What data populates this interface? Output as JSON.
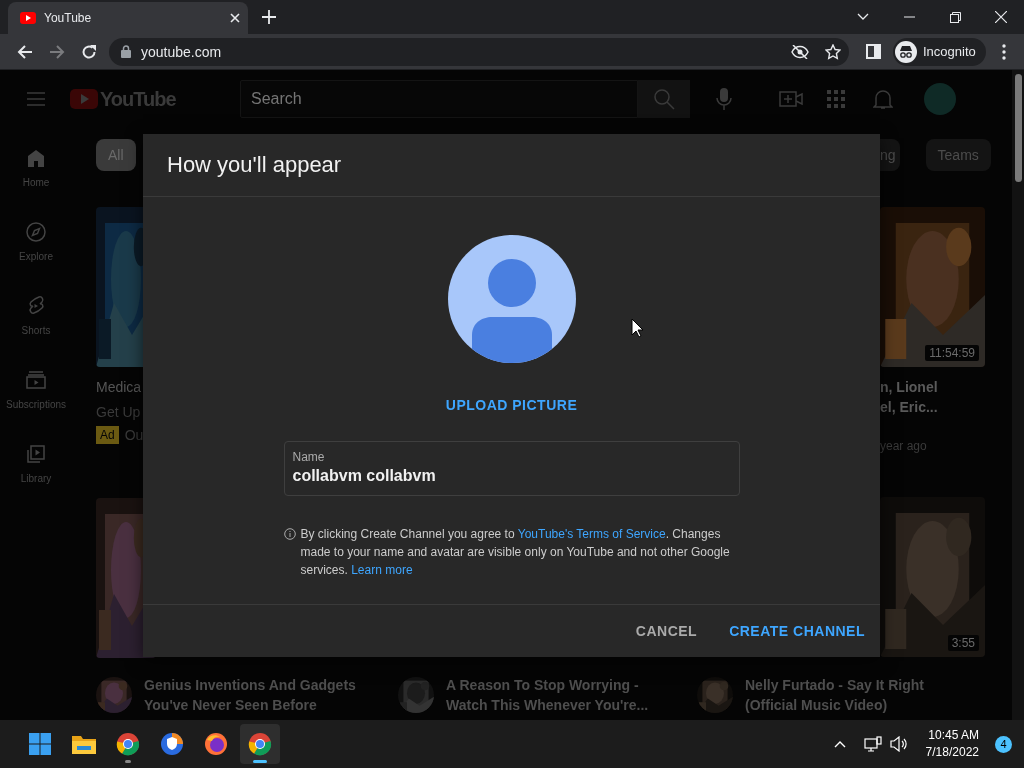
{
  "browser": {
    "tab": {
      "title": "YouTube"
    },
    "address": "youtube.com",
    "profile": "Incognito"
  },
  "masthead": {
    "logo": "YouTube",
    "search_placeholder": "Search"
  },
  "sidebar": {
    "items": [
      {
        "label": "Home"
      },
      {
        "label": "Explore"
      },
      {
        "label": "Shorts"
      },
      {
        "label": "Subscriptions"
      },
      {
        "label": "Library"
      }
    ]
  },
  "chips": [
    {
      "label": "All",
      "selected": true
    },
    {
      "label": "ng",
      "selected": false
    },
    {
      "label": "Teams",
      "selected": false
    }
  ],
  "left_column": {
    "title": "Medica",
    "channel": "Get Up",
    "badge": "Ad",
    "badge_text": "Ou"
  },
  "right_column": {
    "duration": "11:54:59",
    "title_lines": [
      "n, Lionel",
      "el, Eric..."
    ],
    "meta": "year ago",
    "duration_2": "3:55"
  },
  "bottom_row": [
    {
      "title_lines": [
        "Genius Inventions And Gadgets",
        "You've Never Seen Before"
      ]
    },
    {
      "title_lines": [
        "A Reason To Stop Worrying -",
        "Watch This Whenever You're..."
      ]
    },
    {
      "title_lines": [
        "Nelly Furtado - Say It Right",
        "(Official Music Video)"
      ]
    }
  ],
  "dialog": {
    "title": "How you'll appear",
    "upload": "UPLOAD PICTURE",
    "field": {
      "label": "Name",
      "value": "collabvm collabvm"
    },
    "info": {
      "before": "By clicking Create Channel you agree to",
      "link": "YouTube's Terms of Service",
      "after": ". Changes made to your name and avatar are visible only on YouTube and not other Google services.",
      "link2": "Learn more"
    },
    "buttons": [
      {
        "label": "CANCEL",
        "kind": "secondary"
      },
      {
        "label": "CREATE CHANNEL",
        "kind": "primary"
      }
    ]
  },
  "taskbar": {
    "apps": [
      {
        "kind": "start",
        "running": false,
        "selected": false
      },
      {
        "kind": "folder",
        "running": false,
        "selected": false
      },
      {
        "kind": "chrome",
        "running": true,
        "selected": false
      },
      {
        "kind": "shield",
        "running": false,
        "selected": false
      },
      {
        "kind": "firefox",
        "running": false,
        "selected": false
      },
      {
        "kind": "chrome",
        "running": true,
        "selected": true
      }
    ],
    "time": "10:45 AM",
    "date": "7/18/2022",
    "notifications": "4"
  }
}
